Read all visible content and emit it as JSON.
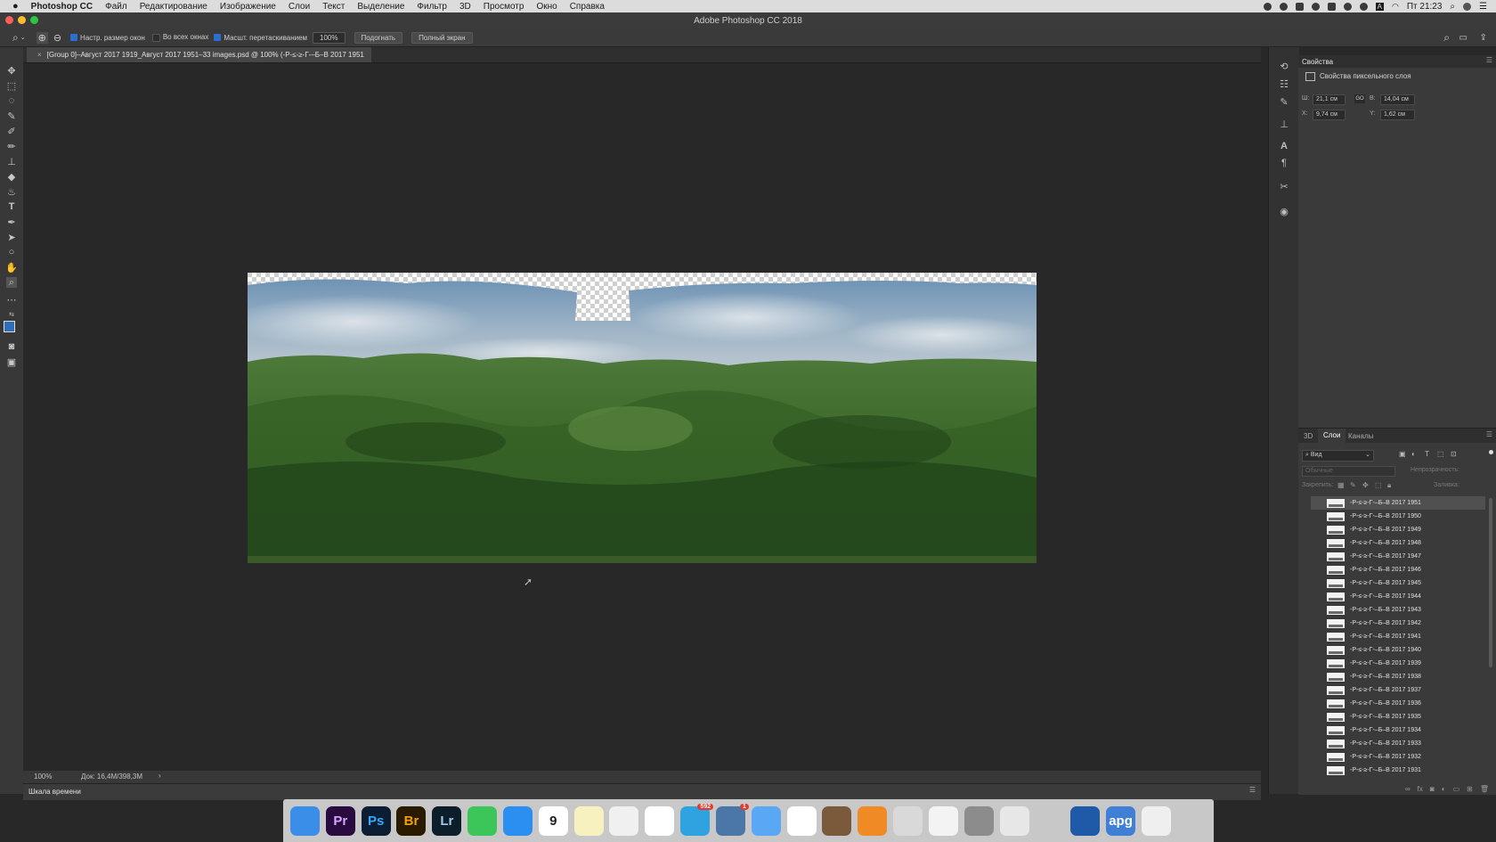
{
  "menubar": {
    "app_name": "Photoshop CC",
    "items": [
      "Файл",
      "Редактирование",
      "Изображение",
      "Слои",
      "Текст",
      "Выделение",
      "Фильтр",
      "3D",
      "Просмотр",
      "Окно",
      "Справка"
    ],
    "time": "Пт 21:23",
    "layout_indicator": "A"
  },
  "window": {
    "title": "Adobe Photoshop CC 2018"
  },
  "options_bar": {
    "resize_windows": "Настр. размер окон",
    "all_windows": "Во всех окнах",
    "scrubby_zoom": "Масшт. перетаскиванием",
    "zoom_value": "100%",
    "fit_button": "Подогнать",
    "fullscreen_button": "Полный экран",
    "checkbox_states": {
      "resize_windows": true,
      "all_windows": false,
      "scrubby_zoom": true
    }
  },
  "document": {
    "tab_title": "[Group 0]–Август 2017 1919_Август 2017 1951–33 images.psd @ 100% (-Р-≤-≥-Г-–Б–В 2017 1951",
    "close_glyph": "×"
  },
  "statusbar": {
    "zoom": "100%",
    "doc_size": "Док: 16,4M/398,3M",
    "arrow": "›"
  },
  "timeline": {
    "label": "Шкала времени"
  },
  "properties": {
    "panel_title": "Свойства",
    "section_title": "Свойства пиксельного слоя",
    "w_label": "Ш:",
    "w_value": "21,1 см",
    "h_label": "В:",
    "h_value": "14,04 см",
    "x_label": "X:",
    "x_value": "9,74 см",
    "y_label": "Y:",
    "y_value": "1,62 см",
    "link_glyph": "GO"
  },
  "layers_panel": {
    "tabs": [
      "3D",
      "Слои",
      "Каналы"
    ],
    "active_tab": "Слои",
    "filter_label": "Вид",
    "blend_mode": "Обычные",
    "opacity_label": "Непрозрачность:",
    "lock_label": "Закрепить:",
    "fill_label": "Заливка:",
    "layers": [
      "-Р-≤-≥-Г-–Б–В 2017 1951",
      "-Р-≤-≥-Г-–Б–В 2017 1950",
      "-Р-≤-≥-Г-–Б–В 2017 1949",
      "-Р-≤-≥-Г-–Б–В 2017 1948",
      "-Р-≤-≥-Г-–Б–В 2017 1947",
      "-Р-≤-≥-Г-–Б–В 2017 1946",
      "-Р-≤-≥-Г-–Б–В 2017 1945",
      "-Р-≤-≥-Г-–Б–В 2017 1944",
      "-Р-≤-≥-Г-–Б–В 2017 1943",
      "-Р-≤-≥-Г-–Б–В 2017 1942",
      "-Р-≤-≥-Г-–Б–В 2017 1941",
      "-Р-≤-≥-Г-–Б–В 2017 1940",
      "-Р-≤-≥-Г-–Б–В 2017 1939",
      "-Р-≤-≥-Г-–Б–В 2017 1938",
      "-Р-≤-≥-Г-–Б–В 2017 1937",
      "-Р-≤-≥-Г-–Б–В 2017 1936",
      "-Р-≤-≥-Г-–Б–В 2017 1935",
      "-Р-≤-≥-Г-–Б–В 2017 1934",
      "-Р-≤-≥-Г-–Б–В 2017 1933",
      "-Р-≤-≥-Г-–Б–В 2017 1932",
      "-Р-≤-≥-Г-–Б–В 2017 1931"
    ]
  },
  "dock": {
    "apps": [
      {
        "name": "finder-icon",
        "label": "",
        "bg": "#3b8ee8",
        "fg": "#ffffff"
      },
      {
        "name": "premiere-icon",
        "label": "Pr",
        "bg": "#2a0b3f",
        "fg": "#d9a2ff"
      },
      {
        "name": "photoshop-icon",
        "label": "Ps",
        "bg": "#0b1e33",
        "fg": "#36a9ff"
      },
      {
        "name": "bridge-icon",
        "label": "Br",
        "bg": "#2a1a00",
        "fg": "#f5a100"
      },
      {
        "name": "lightroom-icon",
        "label": "Lr",
        "bg": "#0d1e2b",
        "fg": "#9ec9e8"
      },
      {
        "name": "facetime-icon",
        "label": "",
        "bg": "#3cc65a",
        "fg": "#ffffff"
      },
      {
        "name": "safari-icon",
        "label": "",
        "bg": "#2a8ff0",
        "fg": "#ffffff"
      },
      {
        "name": "calendar-icon",
        "label": "9",
        "bg": "#ffffff",
        "fg": "#222222"
      },
      {
        "name": "notes-icon",
        "label": "",
        "bg": "#f7f1c0",
        "fg": "#333333"
      },
      {
        "name": "textedit-icon",
        "label": "",
        "bg": "#f0f0f0",
        "fg": "#333333"
      },
      {
        "name": "reminders-icon",
        "label": "",
        "bg": "#ffffff",
        "fg": "#333333"
      },
      {
        "name": "telegram-icon",
        "label": "",
        "bg": "#2fa3e0",
        "fg": "#ffffff",
        "badge": "592"
      },
      {
        "name": "vk-icon",
        "label": "",
        "bg": "#4a76a8",
        "fg": "#ffffff",
        "badge": "1"
      },
      {
        "name": "messages-icon",
        "label": "",
        "bg": "#5aa7f5",
        "fg": "#ffffff"
      },
      {
        "name": "numbers-icon",
        "label": "",
        "bg": "#ffffff",
        "fg": "#2f9e4f"
      },
      {
        "name": "notebook-icon",
        "label": "",
        "bg": "#7a5a3a",
        "fg": "#ffffff"
      },
      {
        "name": "ibooks-icon",
        "label": "",
        "bg": "#f08a24",
        "fg": "#ffffff"
      },
      {
        "name": "vlc-icon",
        "label": "",
        "bg": "#d9d9d9",
        "fg": "#f07a00"
      },
      {
        "name": "itunes-icon",
        "label": "",
        "bg": "#f3f3f3",
        "fg": "#d44cc3"
      },
      {
        "name": "system-preferences-icon",
        "label": "",
        "bg": "#8c8c8c",
        "fg": "#ffffff"
      },
      {
        "name": "preview-icon",
        "label": "",
        "bg": "#e7e7e7",
        "fg": "#2a6fd1"
      },
      {
        "name": "iphone-icon",
        "label": "",
        "bg": "#c8c8c8",
        "fg": "#333333"
      },
      {
        "name": "quicktime-icon",
        "label": "",
        "bg": "#1e5aa8",
        "fg": "#cfe6ff"
      },
      {
        "name": "appstore-icon",
        "label": "apg",
        "bg": "#3f7fd6",
        "fg": "#ffffff"
      },
      {
        "name": "document-icon",
        "label": "",
        "bg": "#efefef",
        "fg": "#555555"
      },
      {
        "name": "trash-icon",
        "label": "",
        "bg": "#c8c8c8",
        "fg": "#6b6b6b"
      }
    ]
  }
}
